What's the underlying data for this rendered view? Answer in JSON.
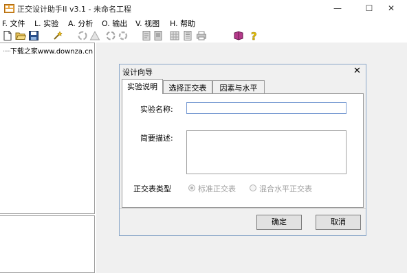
{
  "window": {
    "title": "正交设计助手II v3.1 - 未命名工程",
    "minimize_glyph": "—",
    "maximize_glyph": "☐",
    "close_glyph": "✕"
  },
  "menu": {
    "items": [
      {
        "label": "F. 文件"
      },
      {
        "label": "L. 实验"
      },
      {
        "label": "A. 分析"
      },
      {
        "label": "O. 输出"
      },
      {
        "label": "V. 视图"
      },
      {
        "label": "H. 帮助"
      }
    ]
  },
  "toolbar": {
    "icons": [
      "new-file-icon",
      "open-folder-icon",
      "save-icon",
      "wizard-icon",
      "recycle-icon",
      "triangle-icon",
      "recycle-alt-icon",
      "recycle-gray-icon",
      "doc-icon",
      "doc-alt-icon",
      "grid-icon",
      "page-icon",
      "printer-icon",
      "book-icon",
      "help-icon"
    ]
  },
  "tree": {
    "root_label": "下载之家www.downza.cn",
    "dots": "·····"
  },
  "dialog": {
    "title": "设计向导",
    "close_glyph": "✕",
    "tabs": [
      {
        "label": "实验说明"
      },
      {
        "label": "选择正交表"
      },
      {
        "label": "因素与水平"
      }
    ],
    "experiment_name_label": "实验名称:",
    "experiment_name_value": "",
    "description_label": "简要描述:",
    "description_value": "",
    "table_type_label": "正交表类型",
    "radio_standard_label": "标准正交表",
    "radio_mixed_label": "混合水平正交表",
    "ok_label": "确定",
    "cancel_label": "取消"
  },
  "colors": {
    "dialog_border": "#8aa6c8",
    "workspace_bg": "#f0f0f0",
    "input_focus_border": "#7a9cd3"
  }
}
